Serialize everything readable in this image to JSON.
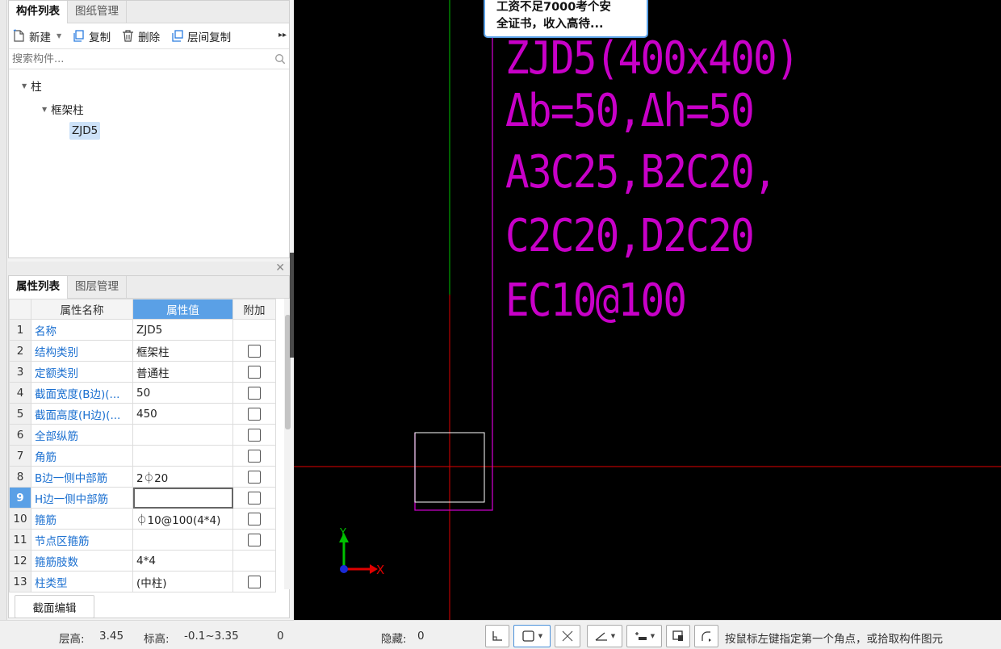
{
  "component_panel": {
    "tabs": [
      "构件列表",
      "图纸管理"
    ],
    "toolbar": {
      "new": "新建",
      "copy": "复制",
      "delete": "删除",
      "floor_copy": "层间复制"
    },
    "search_placeholder": "搜索构件...",
    "tree": {
      "root": "柱",
      "child": "框架柱",
      "leaf": "ZJD5"
    }
  },
  "property_panel": {
    "tabs": [
      "属性列表",
      "图层管理"
    ],
    "columns": [
      "属性名称",
      "属性值",
      "附加"
    ],
    "rows": [
      {
        "num": "1",
        "name": "名称",
        "value": "ZJD5",
        "checkbox": false
      },
      {
        "num": "2",
        "name": "结构类别",
        "value": "框架柱",
        "checkbox": true
      },
      {
        "num": "3",
        "name": "定额类别",
        "value": "普通柱",
        "checkbox": true
      },
      {
        "num": "4",
        "name": "截面宽度(B边)(...",
        "value": "50",
        "checkbox": true
      },
      {
        "num": "5",
        "name": "截面高度(H边)(...",
        "value": "450",
        "checkbox": true
      },
      {
        "num": "6",
        "name": "全部纵筋",
        "value": "",
        "checkbox": true
      },
      {
        "num": "7",
        "name": "角筋",
        "value": "",
        "checkbox": true
      },
      {
        "num": "8",
        "name": "B边一侧中部筋",
        "value": "2⏀20",
        "checkbox": true
      },
      {
        "num": "9",
        "name": "H边一侧中部筋",
        "value": "",
        "checkbox": true
      },
      {
        "num": "10",
        "name": "箍筋",
        "value": "⏀10@100(4*4)",
        "checkbox": true
      },
      {
        "num": "11",
        "name": "节点区箍筋",
        "value": "",
        "checkbox": true
      },
      {
        "num": "12",
        "name": "箍筋肢数",
        "value": "4*4",
        "checkbox": false
      },
      {
        "num": "13",
        "name": "柱类型",
        "value": "(中柱)",
        "checkbox": true
      }
    ],
    "section_edit_button": "截面编辑"
  },
  "canvas": {
    "popup_lines": [
      "工资不足7000考个安",
      "全证书，收入高待..."
    ],
    "cad_text": [
      "ZJD5(400x400)",
      "Δb=50,Δh=50",
      "A3C25,B2C20,",
      "C2C20,D2C20",
      "EC10@100"
    ],
    "axis_y": "Y",
    "axis_x": "X"
  },
  "status": {
    "floor_height_label": "层高:",
    "floor_height_value": "3.45",
    "elevation_label": "标高:",
    "elevation_value": "-0.1~3.35",
    "count": "0",
    "hidden_label": "隐藏:",
    "hidden_value": "0",
    "hint": "按鼠标左键指定第一个角点，或拾取构件图元"
  },
  "colors": {
    "accent": "#5aa0e6",
    "cad_magenta": "#c800c8",
    "cursor_red": "#e00000",
    "axis_green": "#00c000"
  }
}
